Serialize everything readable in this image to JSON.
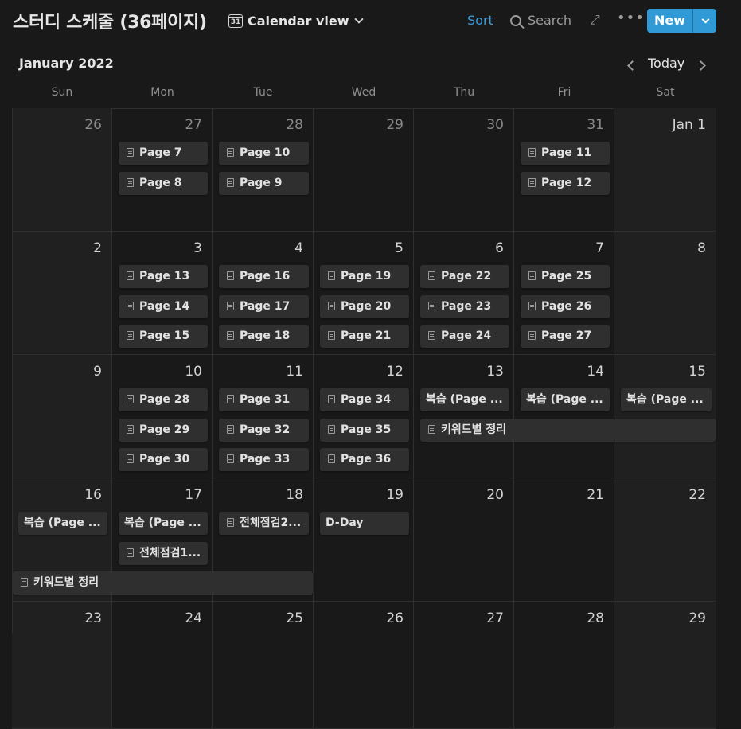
{
  "header": {
    "title": "스터디 스케줄 (36페이지)",
    "view_icon_text": "31",
    "view_label": "Calendar view",
    "sort_label": "Sort",
    "search_label": "Search",
    "expand_glyph": "⤢",
    "more_glyph": "•••",
    "new_label": "New"
  },
  "calendar": {
    "month": "January 2022",
    "today_label": "Today",
    "weekdays": [
      "Sun",
      "Mon",
      "Tue",
      "Wed",
      "Thu",
      "Fri",
      "Sat"
    ],
    "weeks": [
      [
        "26",
        "27",
        "28",
        "29",
        "30",
        "31",
        "Jan 1"
      ],
      [
        "2",
        "3",
        "4",
        "5",
        "6",
        "7",
        "8"
      ],
      [
        "9",
        "10",
        "11",
        "12",
        "13",
        "14",
        "15"
      ],
      [
        "16",
        "17",
        "18",
        "19",
        "20",
        "21",
        "22"
      ],
      [
        "23",
        "24",
        "25",
        "26",
        "27",
        "28",
        "29"
      ]
    ],
    "events": [
      {
        "week": 0,
        "day": 1,
        "slot": 0,
        "label": "Page 7",
        "icon": true
      },
      {
        "week": 0,
        "day": 1,
        "slot": 1,
        "label": "Page 8",
        "icon": true
      },
      {
        "week": 0,
        "day": 2,
        "slot": 0,
        "label": "Page 10",
        "icon": true
      },
      {
        "week": 0,
        "day": 2,
        "slot": 1,
        "label": "Page 9",
        "icon": true
      },
      {
        "week": 0,
        "day": 5,
        "slot": 0,
        "label": "Page 11",
        "icon": true
      },
      {
        "week": 0,
        "day": 5,
        "slot": 1,
        "label": "Page 12",
        "icon": true
      },
      {
        "week": 1,
        "day": 1,
        "slot": 0,
        "label": "Page 13",
        "icon": true
      },
      {
        "week": 1,
        "day": 1,
        "slot": 1,
        "label": "Page 14",
        "icon": true
      },
      {
        "week": 1,
        "day": 1,
        "slot": 2,
        "label": "Page 15",
        "icon": true
      },
      {
        "week": 1,
        "day": 2,
        "slot": 0,
        "label": "Page 16",
        "icon": true
      },
      {
        "week": 1,
        "day": 2,
        "slot": 1,
        "label": "Page 17",
        "icon": true
      },
      {
        "week": 1,
        "day": 2,
        "slot": 2,
        "label": "Page 18",
        "icon": true
      },
      {
        "week": 1,
        "day": 3,
        "slot": 0,
        "label": "Page 19",
        "icon": true
      },
      {
        "week": 1,
        "day": 3,
        "slot": 1,
        "label": "Page 20",
        "icon": true
      },
      {
        "week": 1,
        "day": 3,
        "slot": 2,
        "label": "Page 21",
        "icon": true
      },
      {
        "week": 1,
        "day": 4,
        "slot": 0,
        "label": "Page 22",
        "icon": true
      },
      {
        "week": 1,
        "day": 4,
        "slot": 1,
        "label": "Page 23",
        "icon": true
      },
      {
        "week": 1,
        "day": 4,
        "slot": 2,
        "label": "Page 24",
        "icon": true
      },
      {
        "week": 1,
        "day": 5,
        "slot": 0,
        "label": "Page 25",
        "icon": true
      },
      {
        "week": 1,
        "day": 5,
        "slot": 1,
        "label": "Page 26",
        "icon": true
      },
      {
        "week": 1,
        "day": 5,
        "slot": 2,
        "label": "Page 27",
        "icon": true
      },
      {
        "week": 2,
        "day": 1,
        "slot": 0,
        "label": "Page 28",
        "icon": true
      },
      {
        "week": 2,
        "day": 1,
        "slot": 1,
        "label": "Page 29",
        "icon": true
      },
      {
        "week": 2,
        "day": 1,
        "slot": 2,
        "label": "Page 30",
        "icon": true
      },
      {
        "week": 2,
        "day": 2,
        "slot": 0,
        "label": "Page 31",
        "icon": true
      },
      {
        "week": 2,
        "day": 2,
        "slot": 1,
        "label": "Page 32",
        "icon": true
      },
      {
        "week": 2,
        "day": 2,
        "slot": 2,
        "label": "Page 33",
        "icon": true
      },
      {
        "week": 2,
        "day": 3,
        "slot": 0,
        "label": "Page 34",
        "icon": true
      },
      {
        "week": 2,
        "day": 3,
        "slot": 1,
        "label": "Page 35",
        "icon": true
      },
      {
        "week": 2,
        "day": 3,
        "slot": 2,
        "label": "Page 36",
        "icon": true
      },
      {
        "week": 2,
        "day": 4,
        "slot": 0,
        "label": "복습 (Page ...",
        "icon": false
      },
      {
        "week": 2,
        "day": 5,
        "slot": 0,
        "label": "복습 (Page ...",
        "icon": false
      },
      {
        "week": 2,
        "day": 6,
        "slot": 0,
        "label": "복습 (Page ...",
        "icon": false
      },
      {
        "week": 2,
        "day": 4,
        "slot": 1,
        "span": 3,
        "label": "키워드별 정리",
        "icon": true
      },
      {
        "week": 3,
        "day": 0,
        "slot": 0,
        "label": "복습 (Page ...",
        "icon": false
      },
      {
        "week": 3,
        "day": 1,
        "slot": 0,
        "label": "복습 (Page ...",
        "icon": false
      },
      {
        "week": 3,
        "day": 1,
        "slot": 1,
        "label": "전체점검1...",
        "icon": true
      },
      {
        "week": 3,
        "day": 2,
        "slot": 0,
        "label": "전체점검2...",
        "icon": true
      },
      {
        "week": 3,
        "day": 3,
        "slot": 0,
        "label": "D-Day",
        "icon": false
      },
      {
        "week": 3,
        "day": 0,
        "slot": 2,
        "span": 3,
        "label": "키워드별 정리",
        "icon": true
      }
    ]
  }
}
